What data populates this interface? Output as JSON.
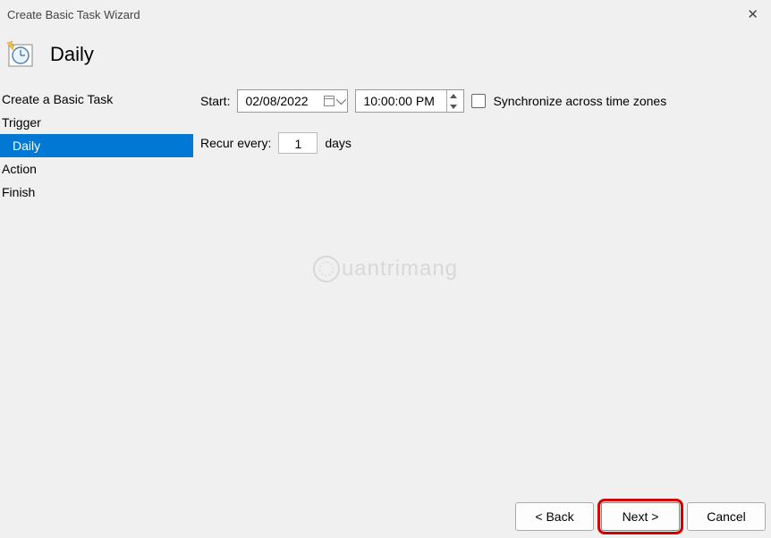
{
  "window": {
    "title": "Create Basic Task Wizard"
  },
  "header": {
    "heading": "Daily"
  },
  "sidebar": {
    "steps": {
      "create": "Create a Basic Task",
      "trigger": "Trigger",
      "daily": "Daily",
      "action": "Action",
      "finish": "Finish"
    }
  },
  "form": {
    "start_label": "Start:",
    "date_value": "02/08/2022",
    "time_value": "10:00:00 PM",
    "sync_label": "Synchronize across time zones",
    "recur_label": "Recur every:",
    "recur_value": "1",
    "recur_unit": "days"
  },
  "buttons": {
    "back": "< Back",
    "next": "Next >",
    "cancel": "Cancel"
  },
  "watermark": "uantrimang"
}
